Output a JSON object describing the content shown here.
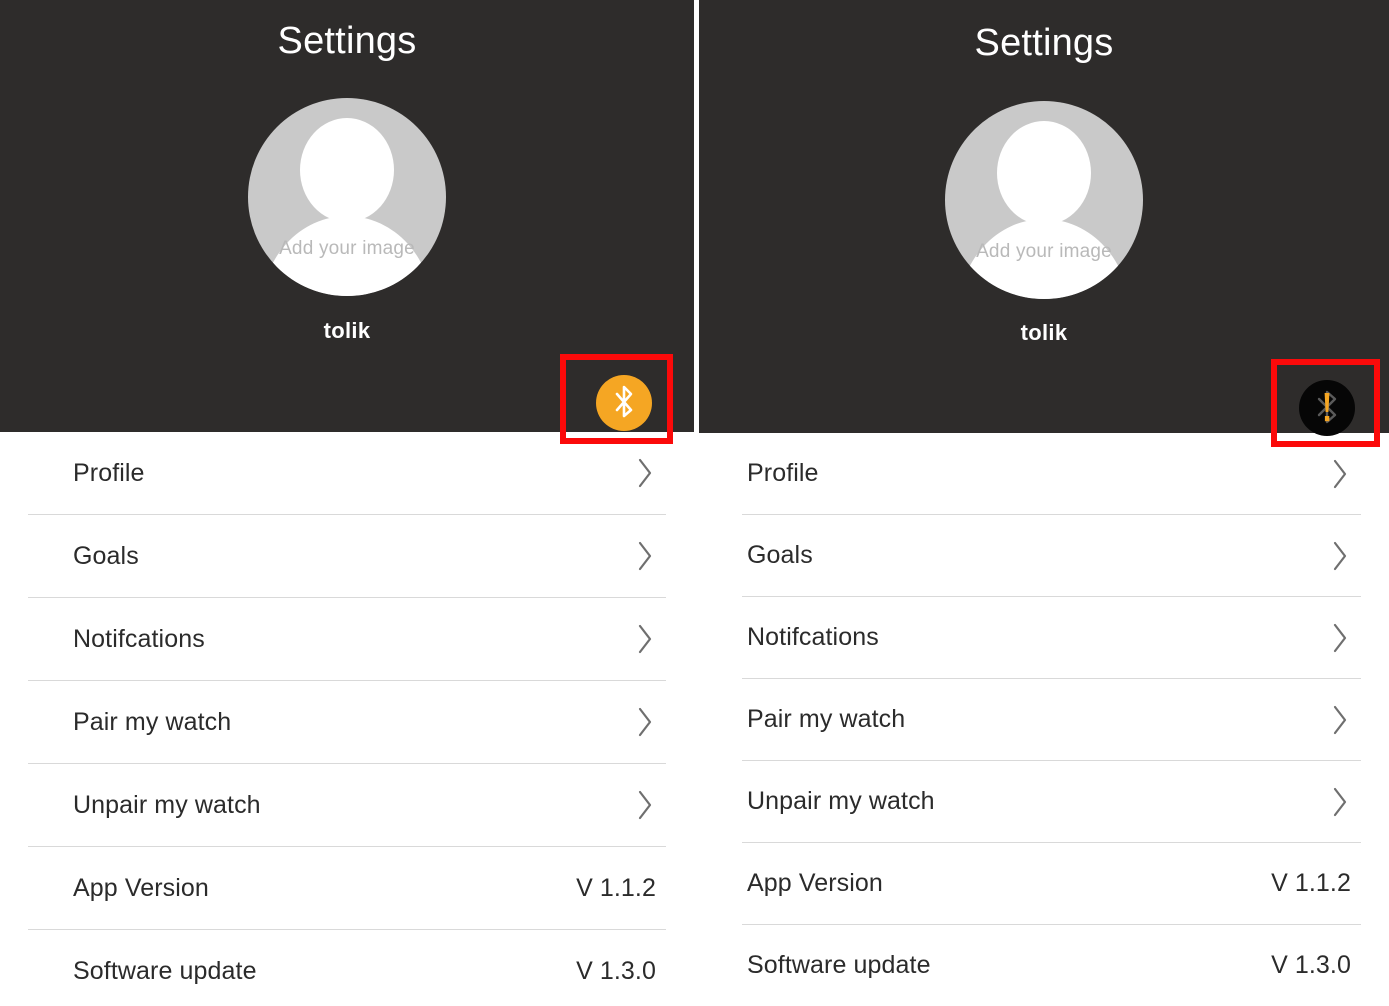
{
  "panels": [
    {
      "id": "left",
      "header": {
        "title": "Settings",
        "avatar_caption": "Add your image",
        "user_name": "tolik"
      },
      "bluetooth": {
        "icon": "bluetooth-icon",
        "state": "connected",
        "badge_color": "#f5a623",
        "glyph_color": "#ffffff",
        "highlight_color": "#fb0a0a"
      },
      "list": [
        {
          "label": "Profile",
          "value": "",
          "accessory": "chevron-right-icon"
        },
        {
          "label": "Goals",
          "value": "",
          "accessory": "chevron-right-icon"
        },
        {
          "label": "Notifcations",
          "value": "",
          "accessory": "chevron-right-icon"
        },
        {
          "label": "Pair my watch",
          "value": "",
          "accessory": "chevron-right-icon"
        },
        {
          "label": "Unpair my watch",
          "value": "",
          "accessory": "chevron-right-icon"
        },
        {
          "label": "App Version",
          "value": "V 1.1.2",
          "accessory": "none"
        },
        {
          "label": "Software update",
          "value": "V 1.3.0",
          "accessory": "none"
        }
      ]
    },
    {
      "id": "right",
      "header": {
        "title": "Settings",
        "avatar_caption": "Add your image",
        "user_name": "tolik"
      },
      "bluetooth": {
        "icon": "bluetooth-alert-icon",
        "state": "disconnected",
        "badge_color": "#060606",
        "glyph_color": "#555555",
        "alert_color": "#f5a623",
        "highlight_color": "#fb0a0a"
      },
      "list": [
        {
          "label": "Profile",
          "value": "",
          "accessory": "chevron-right-icon"
        },
        {
          "label": "Goals",
          "value": "",
          "accessory": "chevron-right-icon"
        },
        {
          "label": "Notifcations",
          "value": "",
          "accessory": "chevron-right-icon"
        },
        {
          "label": "Pair my watch",
          "value": "",
          "accessory": "chevron-right-icon"
        },
        {
          "label": "Unpair my watch",
          "value": "",
          "accessory": "chevron-right-icon"
        },
        {
          "label": "App Version",
          "value": "V 1.1.2",
          "accessory": "none"
        },
        {
          "label": "Software update",
          "value": "V 1.3.0",
          "accessory": "none"
        }
      ]
    }
  ],
  "theme": {
    "header_bg": "#2e2c2b",
    "list_bg": "#ffffff",
    "text_primary": "#2b2b2b",
    "avatar_bg": "#c9c9c9",
    "divider": "#d9d9d9",
    "accent": "#f5a623",
    "highlight": "#fb0a0a"
  }
}
